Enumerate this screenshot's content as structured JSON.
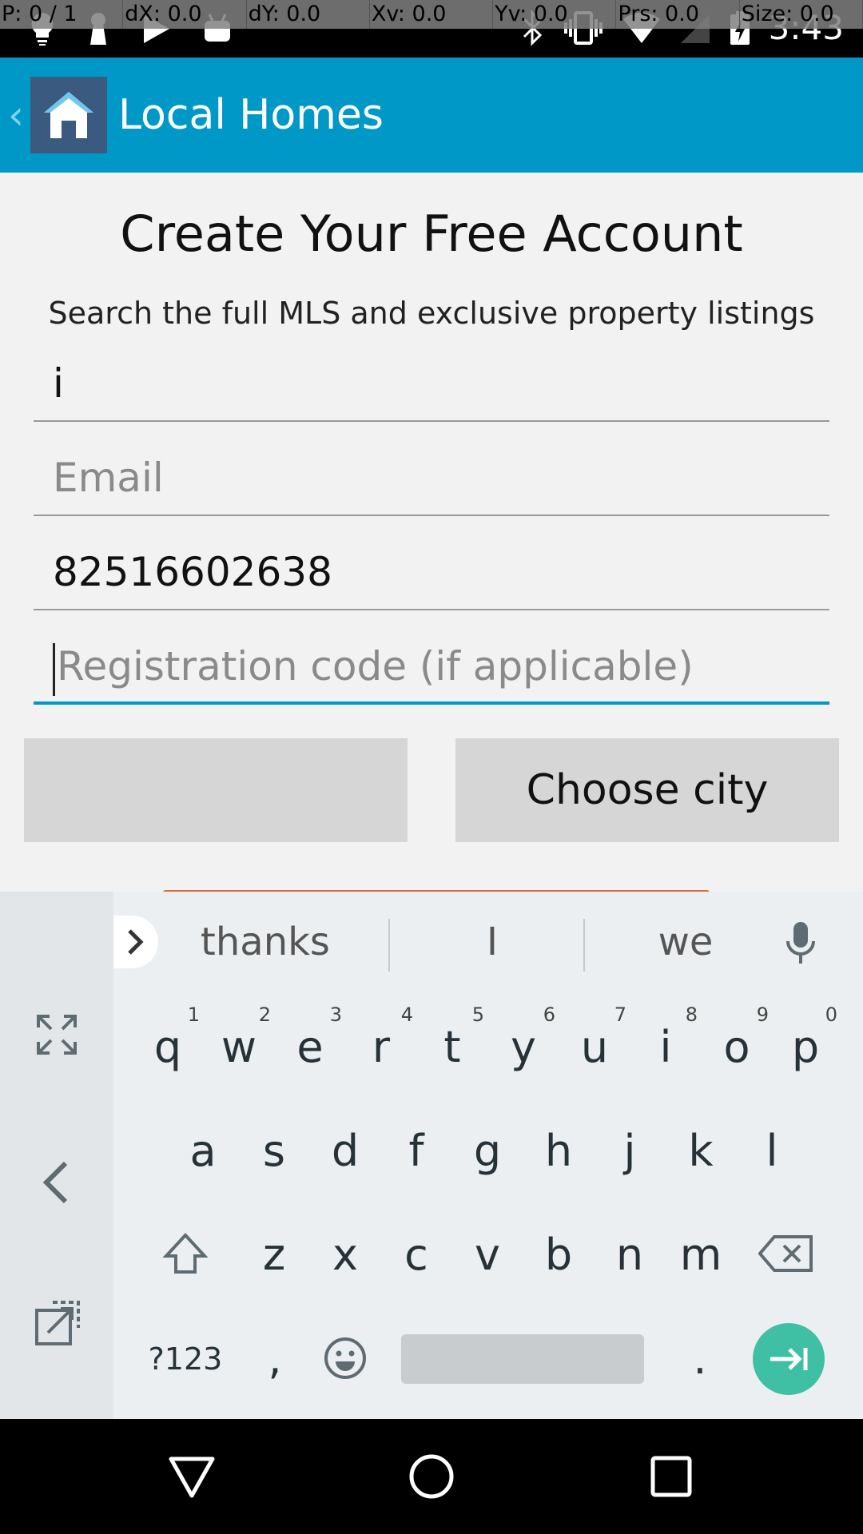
{
  "pointer_overlay": [
    "P: 0 / 1",
    "dX: 0.0",
    "dY: 0.0",
    "Xv: 0.0",
    "Yv: 0.0",
    "Prs: 0.0",
    "Size: 0.0"
  ],
  "status_bar": {
    "time": "3:43"
  },
  "app_bar": {
    "back": "‹",
    "title": "Local Homes"
  },
  "form": {
    "title": "Create Your Free Account",
    "subtitle": "Search the full MLS and exclusive property listings",
    "name_value": "i",
    "email_placeholder": "Email",
    "phone_value": "82516602638",
    "regcode_placeholder": "Registration code (if applicable)",
    "left_button_label": "",
    "choose_city_label": "Choose city"
  },
  "keyboard": {
    "suggestions": [
      "thanks",
      "I",
      "we"
    ],
    "row1": [
      {
        "k": "q",
        "n": "1"
      },
      {
        "k": "w",
        "n": "2"
      },
      {
        "k": "e",
        "n": "3"
      },
      {
        "k": "r",
        "n": "4"
      },
      {
        "k": "t",
        "n": "5"
      },
      {
        "k": "y",
        "n": "6"
      },
      {
        "k": "u",
        "n": "7"
      },
      {
        "k": "i",
        "n": "8"
      },
      {
        "k": "o",
        "n": "9"
      },
      {
        "k": "p",
        "n": "0"
      }
    ],
    "row2": [
      "a",
      "s",
      "d",
      "f",
      "g",
      "h",
      "j",
      "k",
      "l"
    ],
    "row3": [
      "z",
      "x",
      "c",
      "v",
      "b",
      "n",
      "m"
    ],
    "symbols_label": "?123",
    "comma_label": ",",
    "period_label": "."
  },
  "colors": {
    "accent": "#0099c7",
    "enter": "#3fbfa4",
    "orange": "#d96b3c"
  }
}
